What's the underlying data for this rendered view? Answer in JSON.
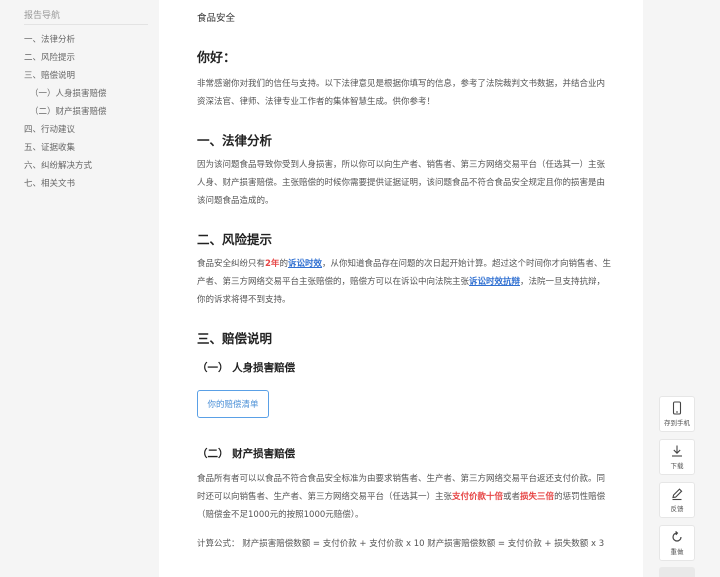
{
  "sidebar": {
    "title": "报告导航",
    "items": [
      {
        "label": "一、法律分析"
      },
      {
        "label": "二、风险提示"
      },
      {
        "label": "三、赔偿说明"
      },
      {
        "label": "（一）人身损害赔偿"
      },
      {
        "label": "（二）财产损害赔偿"
      },
      {
        "label": "四、行动建议"
      },
      {
        "label": "五、证据收集"
      },
      {
        "label": "六、纠纷解决方式"
      },
      {
        "label": "七、相关文书"
      }
    ]
  },
  "report": {
    "topic": "食品安全",
    "greeting": "你好：",
    "intro": "非常感谢你对我们的信任与支持。以下法律意见是根据你填写的信息，参考了法院裁判文书数据，并结合业内资深法官、律师、法律专业工作者的集体智慧生成。供你参考！",
    "section1": {
      "title": "一、法律分析",
      "body": "因为该问题食品导致你受到人身损害，所以你可以向生产者、销售者、第三方网络交易平台（任选其一）主张人身、财产损害赔偿。主张赔偿的时候你需要提供证据证明，该问题食品不符合食品安全规定且你的损害是由该问题食品造成的。"
    },
    "section2": {
      "title": "二、风险提示",
      "p1": "食品安全纠纷只有",
      "years": "2年",
      "p2": "的",
      "term1": "诉讼时效",
      "p3": "，从你知道食品存在问题的次日起开始计算。超过这个时间你才向销售者、生产者、第三方网络交易平台主张赔偿的，赔偿方可以在诉讼中向法院主张",
      "term2": "诉讼时效抗辩",
      "p4": "，法院一旦支持抗辩，你的诉求将得不到支持。"
    },
    "section3": {
      "title": "三、赔偿说明",
      "sub1_title": "（一） 人身损害赔偿",
      "list_button": "你的赔偿清单",
      "sub2_title": "（二） 财产损害赔偿",
      "p1": "食品所有者可以以食品不符合食品安全标准为由要求销售者、生产者、第三方网络交易平台返还支付价款。同时还可以向销售者、生产者、第三方网络交易平台（任选其一）主张",
      "red1": "支付价款十倍",
      "p2": "或者",
      "red2": "损失三倍",
      "p3": "的惩罚性赔偿（赔偿金不足1000元的按照1000元赔偿）。",
      "formula": "计算公式： 财产损害赔偿数额 = 支付价款 + 支付价款 x 10 财产损害赔偿数额 = 支付价款 + 损失数额 x 3"
    }
  },
  "rail": {
    "phone": "存到手机",
    "download": "下载",
    "feedback": "反馈",
    "redo": "重做"
  },
  "icons": {
    "phone": "phone-icon",
    "download": "download-icon",
    "feedback": "pencil-icon",
    "redo": "refresh-icon"
  },
  "colors": {
    "accent_red": "#e64545",
    "link_blue": "#2f6fd1",
    "button_border": "#5aa0e6"
  }
}
